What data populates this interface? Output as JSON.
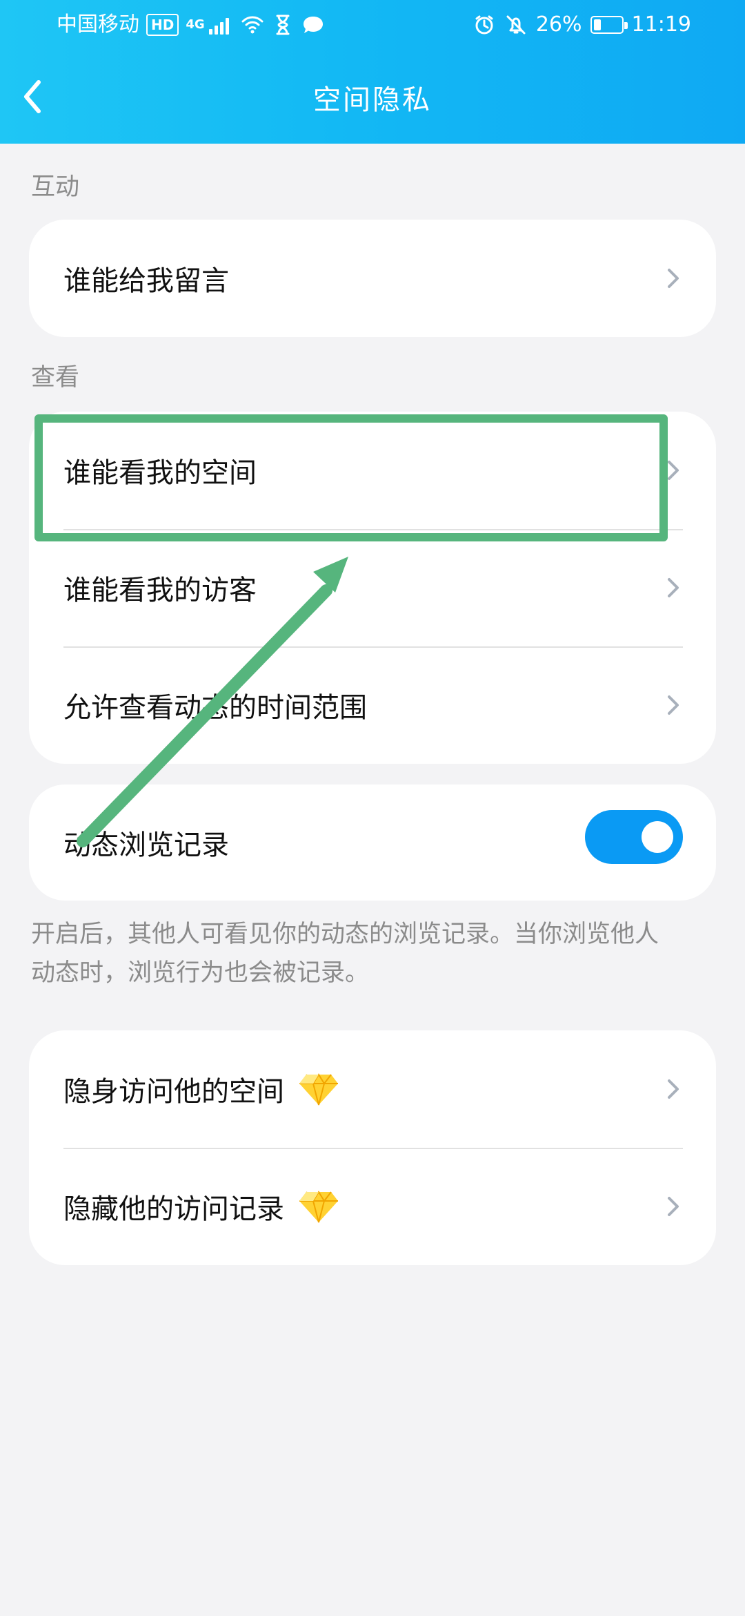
{
  "status_bar": {
    "carrier": "中国移动",
    "hd_badge": "HD",
    "network": "4G",
    "battery": "26%",
    "battery_level": 0.26,
    "time": "11:19",
    "icons": [
      "wifi-icon",
      "hourglass-icon",
      "message-icon",
      "alarm-icon",
      "mute-icon"
    ]
  },
  "header": {
    "title": "空间隐私",
    "back_icon": "chevron-left-icon"
  },
  "sections": [
    {
      "label": "互动",
      "items": [
        {
          "label": "谁能给我留言"
        }
      ]
    },
    {
      "label": "查看",
      "items": [
        {
          "label": "谁能看我的空间"
        },
        {
          "label": "谁能看我的访客"
        },
        {
          "label": "允许查看动态的时间范围"
        }
      ]
    }
  ],
  "toggle_card": {
    "label": "动态浏览记录",
    "enabled": true,
    "note": "开启后，其他人可看见你的动态的浏览记录。当你浏览他人动态时，浏览行为也会被记录。"
  },
  "vip_card": {
    "items": [
      {
        "label": "隐身访问他的空间",
        "icon": "diamond-icon"
      },
      {
        "label": "隐藏他的访问记录",
        "icon": "diamond-icon"
      }
    ]
  },
  "colors": {
    "header_start": "#1fc6f5",
    "header_end": "#0fa9f3",
    "toggle_on": "#0a9af4",
    "highlight_green": "#56b57d",
    "background": "#f3f3f5"
  }
}
